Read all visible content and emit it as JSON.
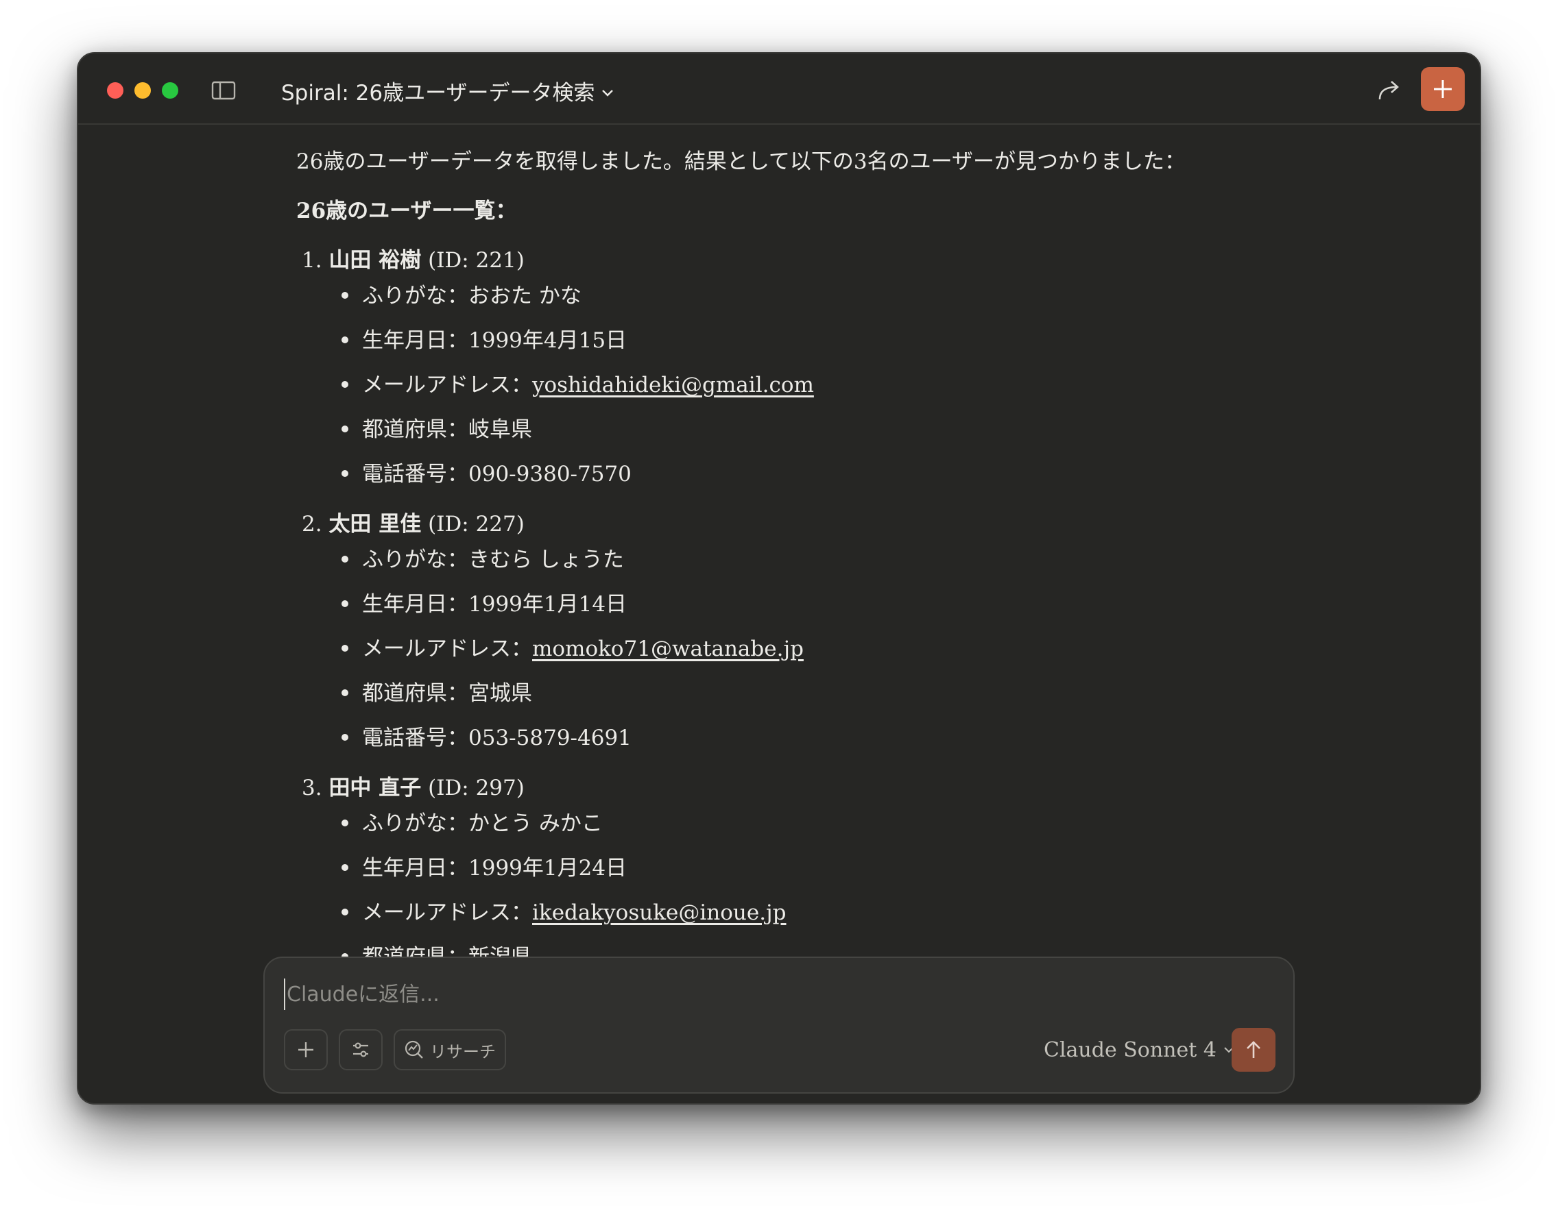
{
  "window": {
    "title": "Spiral: 26歳ユーザーデータ検索"
  },
  "message": {
    "intro": "26歳のユーザーデータを取得しました。結果として以下の3名のユーザーが見つかりました：",
    "heading": "26歳のユーザー一覧：",
    "users": [
      {
        "number": "1.",
        "name": "山田 裕樹",
        "id": "(ID: 221)",
        "furigana_label": "ふりがな：",
        "furigana": "おおた かな",
        "birth_label": "生年月日：",
        "birth": "1999年4月15日",
        "email_label": "メールアドレス：",
        "email": "yoshidahideki@gmail.com",
        "pref_label": "都道府県：",
        "pref": "岐阜県",
        "phone_label": "電話番号：",
        "phone": "090-9380-7570"
      },
      {
        "number": "2.",
        "name": "太田 里佳",
        "id": "(ID: 227)",
        "furigana_label": "ふりがな：",
        "furigana": "きむら しょうた",
        "birth_label": "生年月日：",
        "birth": "1999年1月14日",
        "email_label": "メールアドレス：",
        "email": "momoko71@watanabe.jp",
        "pref_label": "都道府県：",
        "pref": "宮城県",
        "phone_label": "電話番号：",
        "phone": "053-5879-4691"
      },
      {
        "number": "3.",
        "name": "田中 直子",
        "id": "(ID: 297)",
        "furigana_label": "ふりがな：",
        "furigana": "かとう みかこ",
        "birth_label": "生年月日：",
        "birth": "1999年1月24日",
        "email_label": "メールアドレス：",
        "email": "ikedakyosuke@inoue.jp",
        "pref_label": "都道府県：",
        "pref": "新潟県"
      }
    ]
  },
  "composer": {
    "placeholder": "Claudeに返信...",
    "research_label": "リサーチ",
    "model_label": "Claude Sonnet 4"
  },
  "colors": {
    "window_bg": "#262624",
    "accent": "#c96442",
    "send_button": "#8a4a34",
    "text": "#ecebe7"
  },
  "icons": [
    "sidebar-toggle-icon",
    "chevron-down-icon",
    "share-icon",
    "plus-icon",
    "sliders-icon",
    "research-icon",
    "arrow-up-icon"
  ]
}
